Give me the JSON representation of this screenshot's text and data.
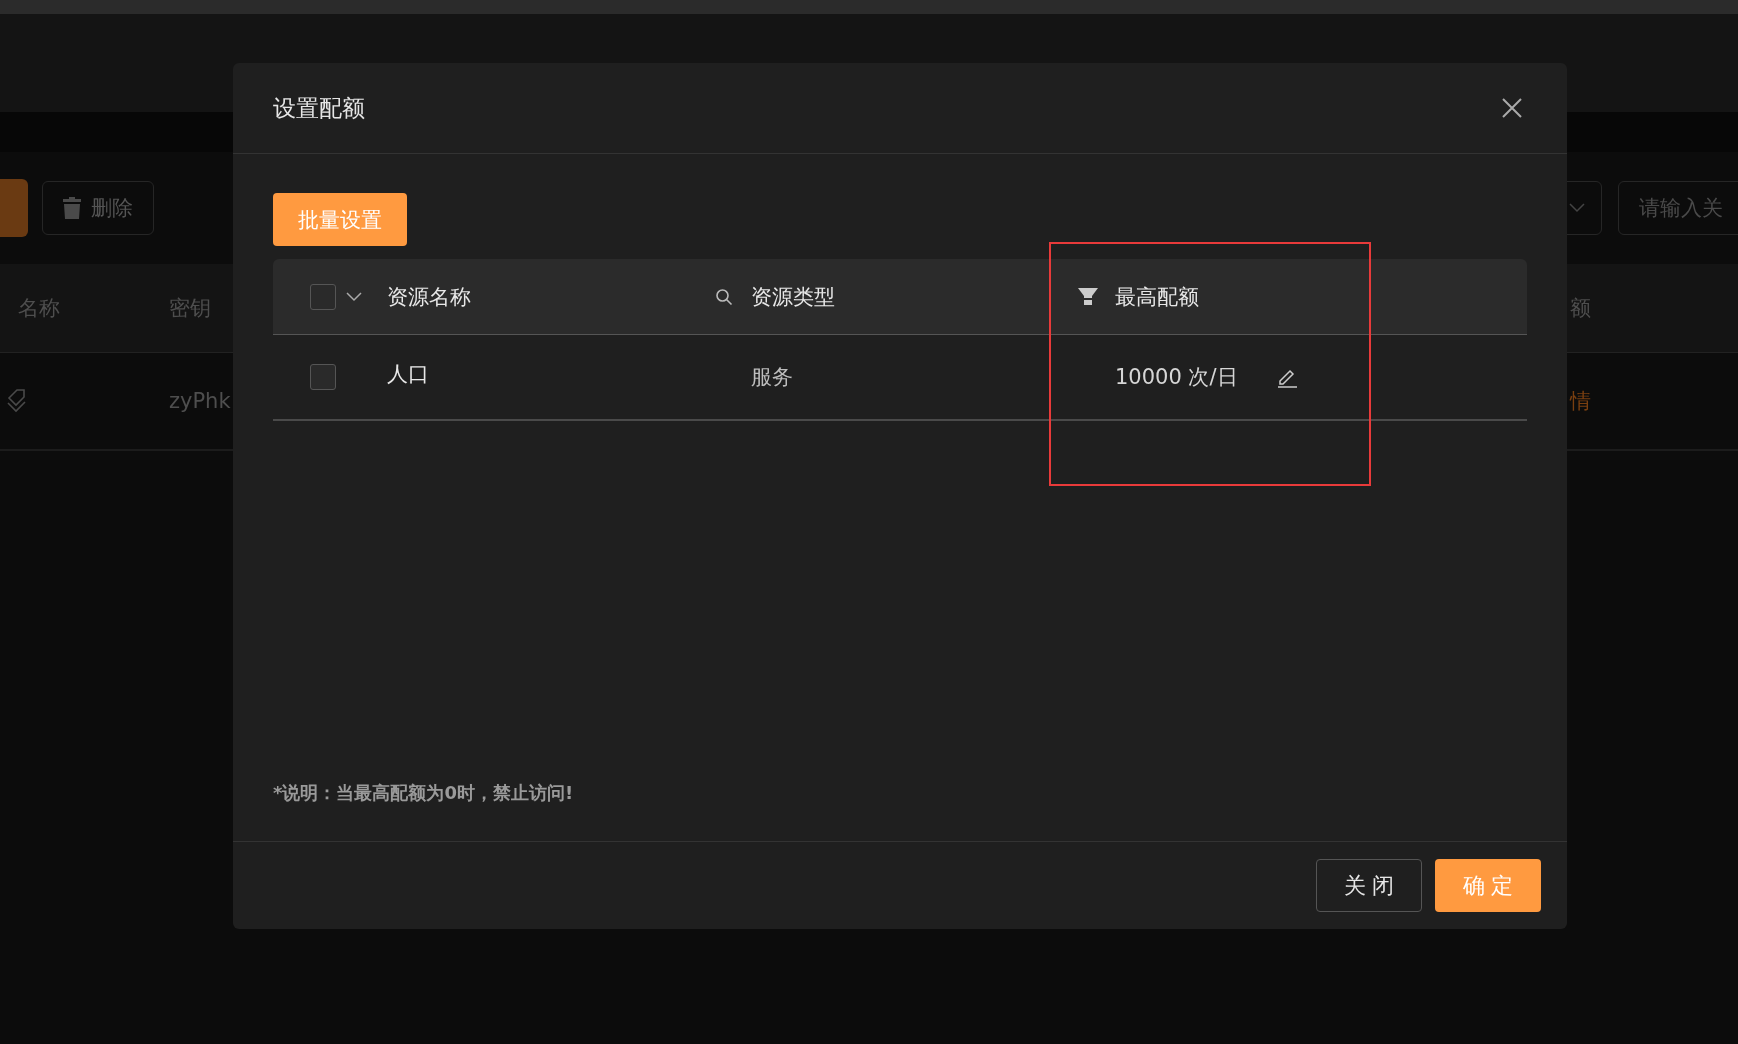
{
  "toolbar": {
    "delete_button": "删除",
    "search": {
      "placeholder": "请输入关"
    }
  },
  "background_table": {
    "columns": [
      "名称",
      "密钥",
      "额"
    ],
    "rows": [
      {
        "key": "zyPhk",
        "action": "情"
      }
    ]
  },
  "dialog": {
    "title": "设置配额",
    "batch_button": "批量设置",
    "table": {
      "columns": [
        "资源名称",
        "资源类型",
        "最高配额"
      ],
      "header_checked": false,
      "rows": [
        {
          "name": "人口",
          "type": "服务",
          "quota": "10000 次/日",
          "checked": false
        }
      ]
    },
    "note": "*说明：当最高配额为0时，禁止访问!",
    "buttons": [
      {
        "label": "关 闭",
        "kind": "default"
      },
      {
        "label": "确 定",
        "kind": "primary"
      }
    ]
  }
}
